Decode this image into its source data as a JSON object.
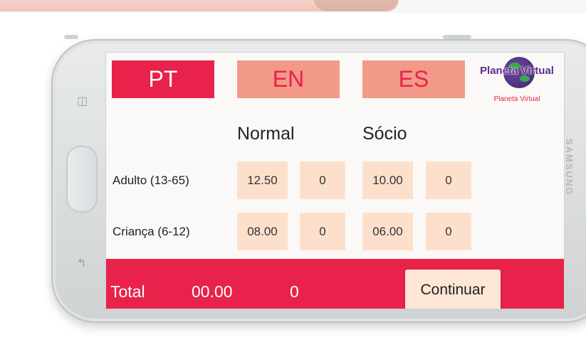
{
  "languages": {
    "pt": "PT",
    "en": "EN",
    "es": "ES"
  },
  "logo": {
    "text": "Planeta Virtual",
    "subtitle": "Planeta Virtual"
  },
  "columns": {
    "normal": "Normal",
    "socio": "Sócio"
  },
  "rows": [
    {
      "label": "Adulto (13-65)",
      "normal_price": "12.50",
      "normal_qty": "0",
      "socio_price": "10.00",
      "socio_qty": "0"
    },
    {
      "label": "Criança (6-12)",
      "normal_price": "08.00",
      "normal_qty": "0",
      "socio_price": "06.00",
      "socio_qty": "0"
    }
  ],
  "footer": {
    "total_label": "Total",
    "total_amount": "00.00",
    "total_count": "0",
    "continue_label": "Continuar"
  },
  "device": {
    "brand": "SAMSUNG"
  },
  "colors": {
    "accent": "#e8224a",
    "inactive_lang": "#f29988",
    "cell": "#fde0cc"
  }
}
